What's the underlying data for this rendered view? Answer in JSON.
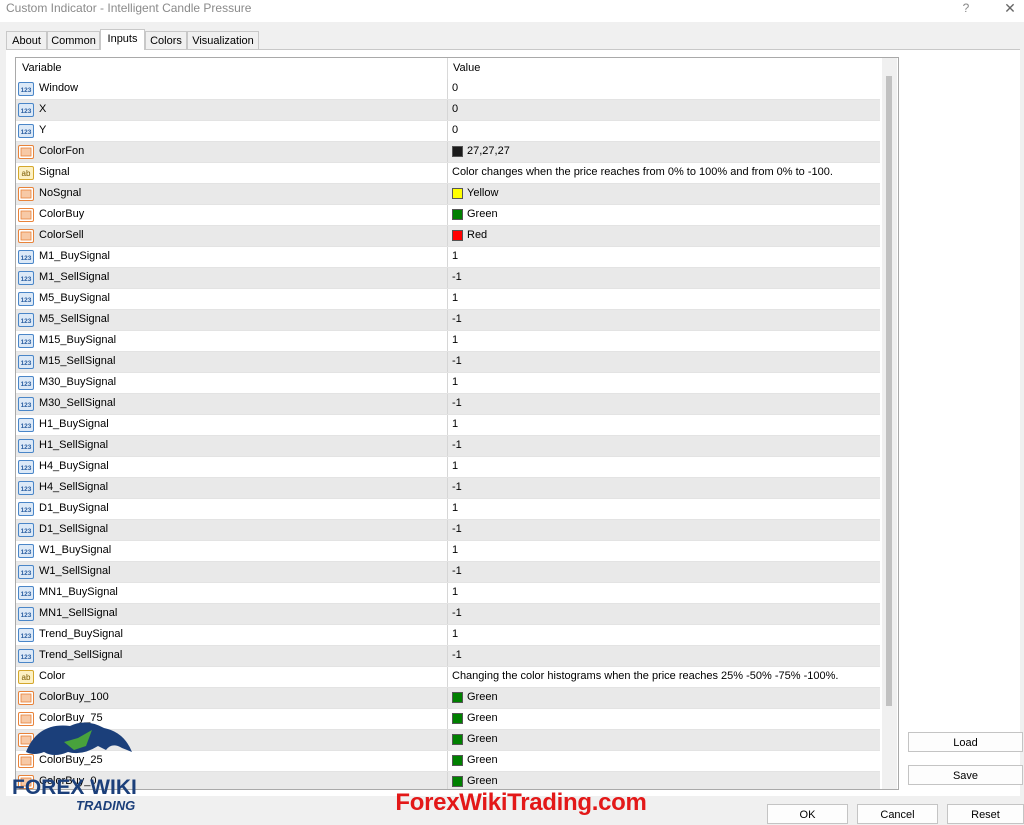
{
  "window": {
    "title": "Custom Indicator - Intelligent  Candle Pressure",
    "help_label": "?",
    "close_label": "✕"
  },
  "tabs": [
    {
      "label": "About"
    },
    {
      "label": "Common"
    },
    {
      "label": "Inputs"
    },
    {
      "label": "Colors"
    },
    {
      "label": "Visualization"
    }
  ],
  "active_tab": "Inputs",
  "grid": {
    "columns": {
      "variable": "Variable",
      "value": "Value"
    },
    "rows": [
      {
        "type": "int",
        "variable": "Window",
        "value": "0"
      },
      {
        "type": "int",
        "variable": "X",
        "value": "0"
      },
      {
        "type": "int",
        "variable": "Y",
        "value": "0"
      },
      {
        "type": "color",
        "variable": "ColorFon",
        "value": "27,27,27",
        "swatch": "#1b1b1b"
      },
      {
        "type": "string",
        "variable": "Signal",
        "value": "Color changes when the price reaches from 0% to 100% and from 0% to -100."
      },
      {
        "type": "color",
        "variable": "NoSgnal",
        "value": "Yellow",
        "swatch": "#ffff00"
      },
      {
        "type": "color",
        "variable": "ColorBuy",
        "value": "Green",
        "swatch": "#008000"
      },
      {
        "type": "color",
        "variable": "ColorSell",
        "value": "Red",
        "swatch": "#ff0000"
      },
      {
        "type": "int",
        "variable": "M1_BuySignal",
        "value": "1"
      },
      {
        "type": "int",
        "variable": "M1_SellSignal",
        "value": "-1"
      },
      {
        "type": "int",
        "variable": "M5_BuySignal",
        "value": "1"
      },
      {
        "type": "int",
        "variable": "M5_SellSignal",
        "value": "-1"
      },
      {
        "type": "int",
        "variable": "M15_BuySignal",
        "value": "1"
      },
      {
        "type": "int",
        "variable": "M15_SellSignal",
        "value": "-1"
      },
      {
        "type": "int",
        "variable": "M30_BuySignal",
        "value": "1"
      },
      {
        "type": "int",
        "variable": "M30_SellSignal",
        "value": "-1"
      },
      {
        "type": "int",
        "variable": "H1_BuySignal",
        "value": "1"
      },
      {
        "type": "int",
        "variable": "H1_SellSignal",
        "value": "-1"
      },
      {
        "type": "int",
        "variable": "H4_BuySignal",
        "value": "1"
      },
      {
        "type": "int",
        "variable": "H4_SellSignal",
        "value": "-1"
      },
      {
        "type": "int",
        "variable": "D1_BuySignal",
        "value": "1"
      },
      {
        "type": "int",
        "variable": "D1_SellSignal",
        "value": "-1"
      },
      {
        "type": "int",
        "variable": "W1_BuySignal",
        "value": "1"
      },
      {
        "type": "int",
        "variable": "W1_SellSignal",
        "value": "-1"
      },
      {
        "type": "int",
        "variable": "MN1_BuySignal",
        "value": "1"
      },
      {
        "type": "int",
        "variable": "MN1_SellSignal",
        "value": "-1"
      },
      {
        "type": "int",
        "variable": "Trend_BuySignal",
        "value": "1"
      },
      {
        "type": "int",
        "variable": "Trend_SellSignal",
        "value": "-1"
      },
      {
        "type": "string",
        "variable": "Color",
        "value": "Changing the color histograms when the price reaches 25% -50% -75% -100%."
      },
      {
        "type": "color",
        "variable": "ColorBuy_100",
        "value": "Green",
        "swatch": "#008000"
      },
      {
        "type": "color",
        "variable": "ColorBuy_75",
        "value": "Green",
        "swatch": "#008000"
      },
      {
        "type": "color",
        "variable": "ColorBuy_50",
        "value": "Green",
        "swatch": "#008000"
      },
      {
        "type": "color",
        "variable": "ColorBuy_25",
        "value": "Green",
        "swatch": "#008000"
      },
      {
        "type": "color",
        "variable": "ColorBuy_0",
        "value": "Green",
        "swatch": "#008000"
      }
    ]
  },
  "buttons": {
    "load": "Load",
    "save": "Save",
    "ok": "OK",
    "cancel": "Cancel",
    "reset": "Reset"
  },
  "overlay": {
    "logo_line1": "FOREX WIKI",
    "logo_line2": "TRADING",
    "watermark": "ForexWikiTrading.com"
  },
  "colors": {
    "int_icon": "#4a86c8",
    "string_icon": "#e8c24a",
    "color_icon": "#e8833a",
    "watermark": "#e31818"
  }
}
